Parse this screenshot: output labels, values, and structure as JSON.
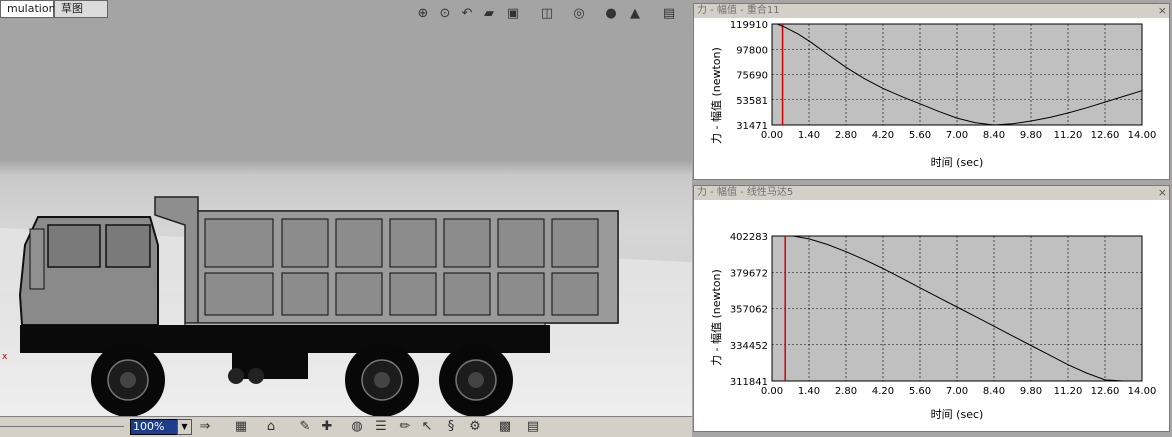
{
  "viewport": {
    "tabs": [
      {
        "label": "mulation",
        "active": true
      },
      {
        "label": "草图",
        "active": false
      }
    ],
    "toolbar_icons": [
      "zoom-to-fit-icon",
      "zoom-area-icon",
      "previous-view-icon",
      "section-view-icon",
      "view-orientation-icon",
      "display-style-icon",
      "hide-show-icon",
      "edit-appearance-icon",
      "scene-icon",
      "view-settings-icon"
    ]
  },
  "bottom_toolbar": {
    "zoom_value": "100%",
    "icons": [
      "arrow-right-icon",
      "save-icon",
      "home-icon",
      "motion-study-icon",
      "add-component-icon",
      "3d-view-icon",
      "list-icon",
      "pencil-icon",
      "pointer-icon",
      "spring-icon",
      "gear-icon",
      "calculate-icon",
      "results-icon"
    ]
  },
  "plots": [
    {
      "title": "力 - 幅值 - 重合11",
      "ylabel": "力 - 幅值 (newton)",
      "xlabel": "时间 (sec)",
      "chart_data": {
        "type": "line",
        "x_ticks": [
          "0.00",
          "1.40",
          "2.80",
          "4.20",
          "5.60",
          "7.00",
          "8.40",
          "9.80",
          "11.20",
          "12.60",
          "14.00"
        ],
        "y_ticks": [
          "119910",
          "97800",
          "75690",
          "53581",
          "31471"
        ],
        "ylim": [
          31471,
          119910
        ],
        "xlim": [
          0,
          14
        ],
        "grid": true,
        "marker_x": 0.4,
        "series": [
          {
            "x": [
              0.2,
              0.5,
              1.0,
              1.5,
              2.0,
              2.8,
              3.5,
              4.2,
              5.0,
              5.6,
              6.3,
              7.0,
              7.7,
              8.4,
              9.1,
              9.8,
              10.5,
              11.2,
              11.9,
              12.6,
              13.3,
              14.0
            ],
            "y": [
              119910,
              117000,
              111000,
              103500,
              95000,
              82000,
              72000,
              63500,
              55500,
              50000,
              43500,
              37500,
              33500,
              31471,
              32500,
              35000,
              38000,
              42000,
              46500,
              51500,
              56500,
              61500
            ]
          }
        ]
      }
    },
    {
      "title": "力 - 幅值 - 线性马达5",
      "ylabel": "力 - 幅值 (newton)",
      "xlabel": "时间 (sec)",
      "chart_data": {
        "type": "line",
        "x_ticks": [
          "0.00",
          "1.40",
          "2.80",
          "4.20",
          "5.60",
          "7.00",
          "8.40",
          "9.80",
          "11.20",
          "12.60",
          "14.00"
        ],
        "y_ticks": [
          "402283",
          "379672",
          "357062",
          "334452",
          "311841"
        ],
        "ylim": [
          311841,
          402283
        ],
        "xlim": [
          0,
          14
        ],
        "grid": true,
        "marker_x": 0.5,
        "series": [
          {
            "x": [
              0.8,
              1.4,
              2.1,
              2.8,
              3.5,
              4.2,
              4.9,
              5.6,
              6.3,
              7.0,
              7.7,
              8.4,
              9.1,
              9.8,
              10.5,
              11.2,
              11.9,
              12.6,
              13.3,
              14.0
            ],
            "y": [
              402283,
              400500,
              397000,
              392500,
              387500,
              382000,
              376000,
              370000,
              364000,
              358000,
              352000,
              346000,
              340000,
              334000,
              328000,
              322000,
              316800,
              312500,
              311841,
              311841
            ]
          }
        ]
      }
    }
  ]
}
